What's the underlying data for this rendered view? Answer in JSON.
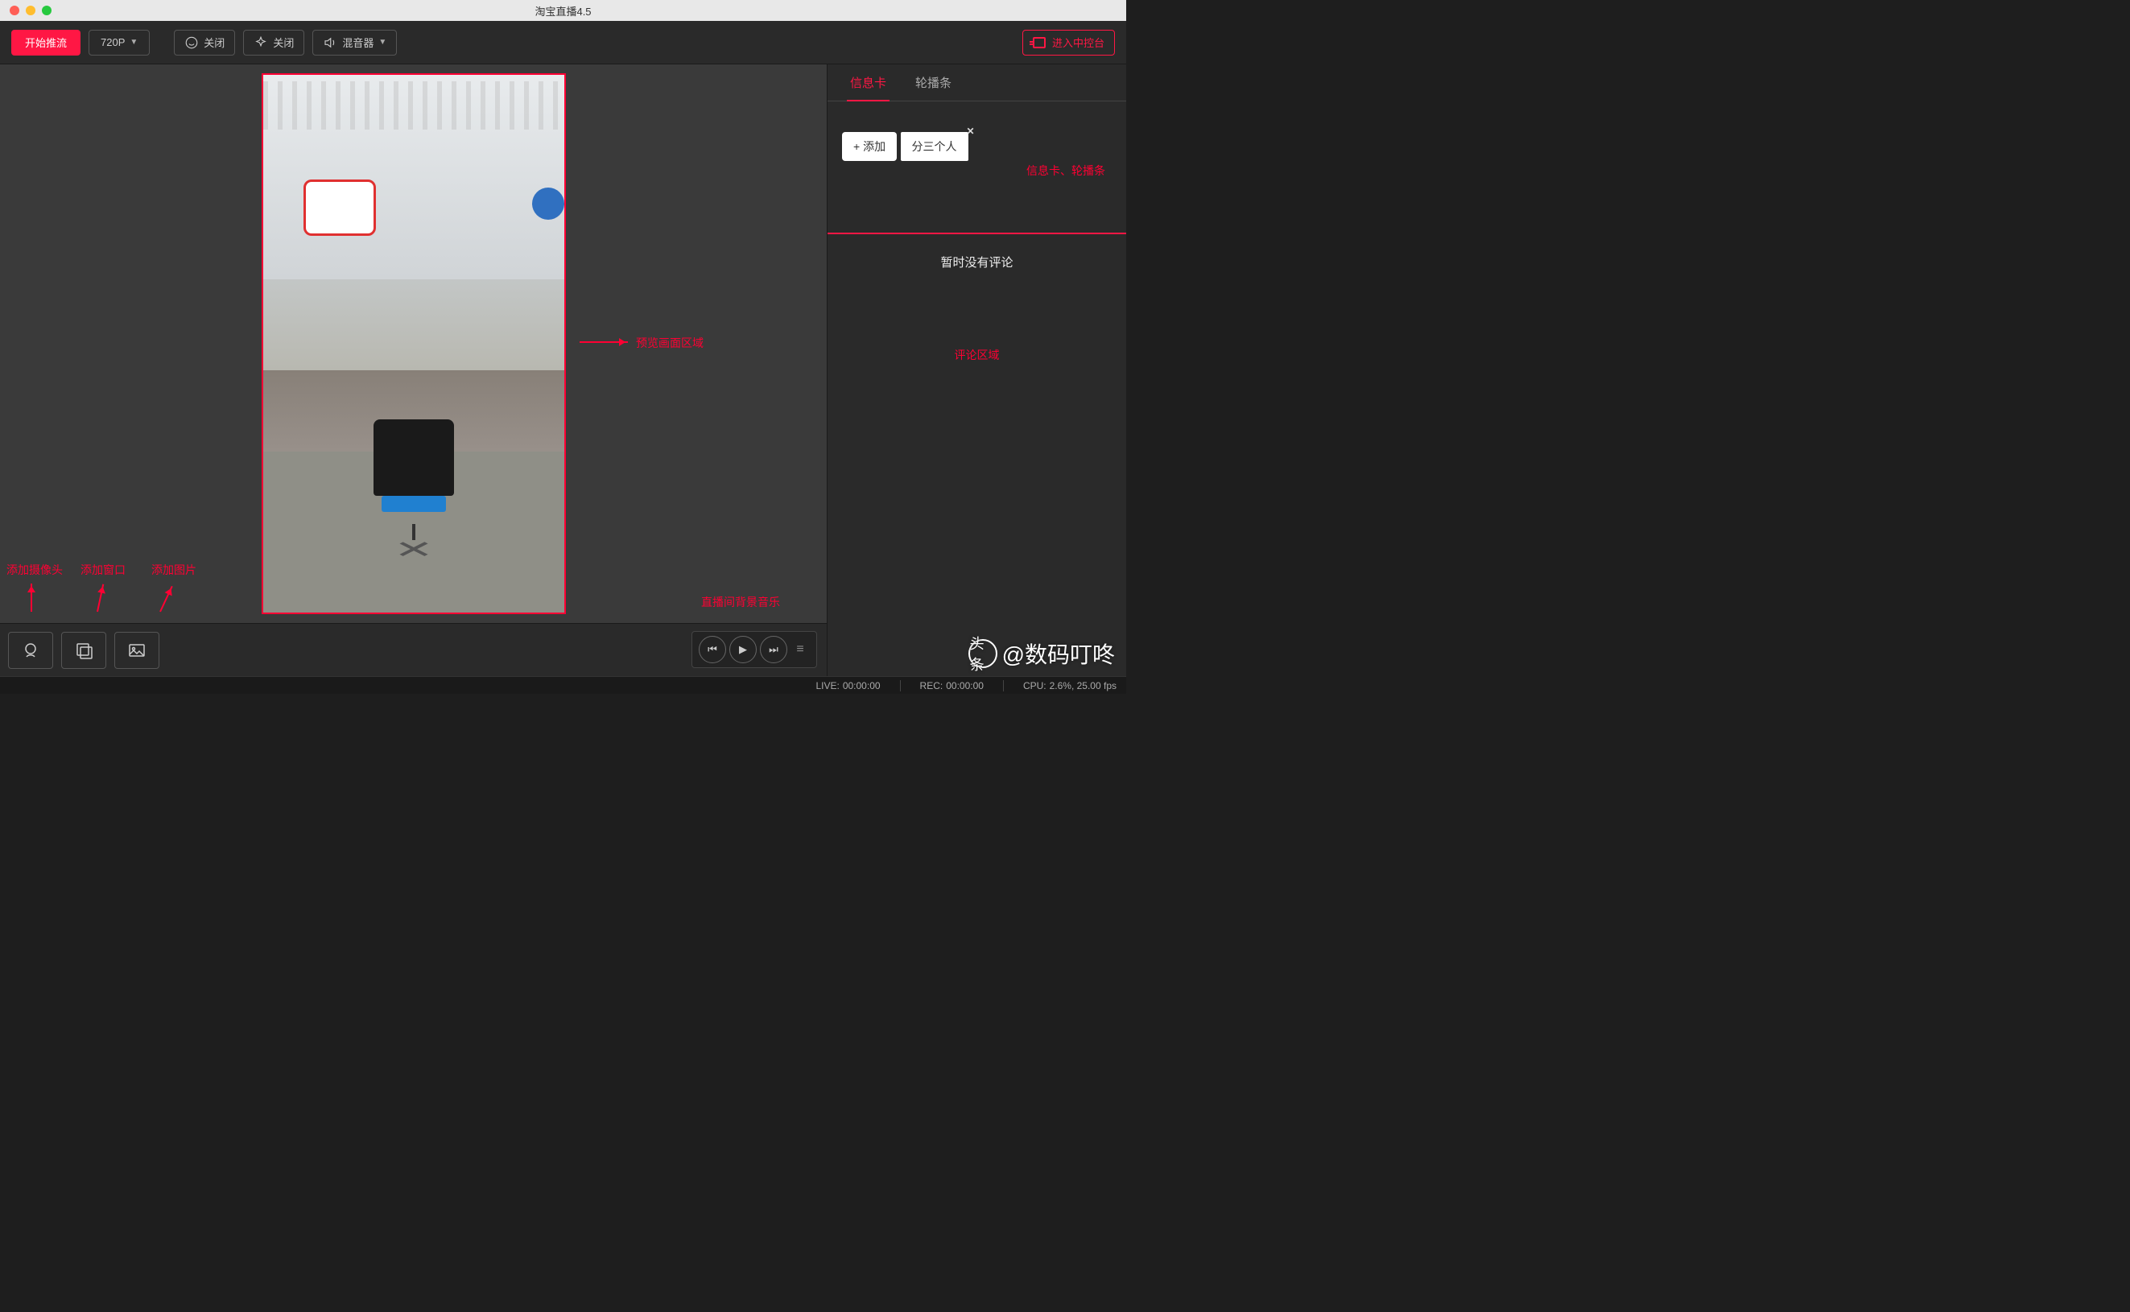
{
  "window": {
    "title": "淘宝直播4.5"
  },
  "toolbar": {
    "start_stream": "开始推流",
    "resolution": "720P",
    "beauty_close": "关闭",
    "effect_close": "关闭",
    "mixer": "混音器",
    "console": "进入中控台"
  },
  "annotations": {
    "preview_area": "预览画面区域",
    "add_camera": "添加摄像头",
    "add_window": "添加窗口",
    "add_image": "添加图片",
    "bg_music": "直播间背景音乐",
    "info_carousel": "信息卡、轮播条",
    "comment_area": "评论区域"
  },
  "right": {
    "tab_info": "信息卡",
    "tab_carousel": "轮播条",
    "add_button": "+ 添加",
    "card_text": "分三个人",
    "no_comments": "暂时没有评论"
  },
  "status": {
    "live_label": "LIVE:",
    "live_time": "00:00:00",
    "rec_label": "REC:",
    "rec_time": "00:00:00",
    "cpu_label": "CPU:",
    "cpu_value": "2.6%, 25.00 fps"
  },
  "watermark": {
    "logo": "头条",
    "text": "@数码叮咚"
  }
}
